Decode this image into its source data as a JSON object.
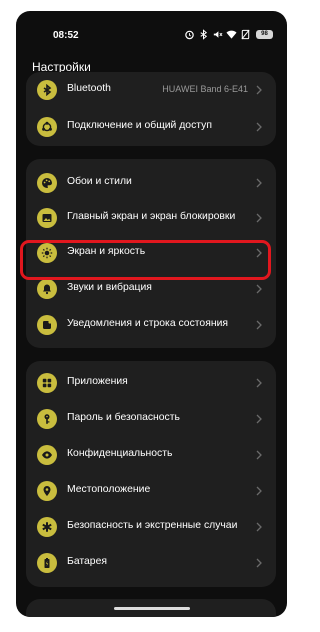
{
  "status_bar": {
    "time": "08:52",
    "icons": [
      "alarm-icon",
      "bluetooth-icon",
      "silent-icon",
      "wifi-icon",
      "no-sim-icon"
    ],
    "battery": "98"
  },
  "header": {
    "title": "Настройки"
  },
  "groups": [
    {
      "items": [
        {
          "label": "Bluetooth",
          "value": "HUAWEI Band 6-E41",
          "icon": "bluetooth-icon"
        },
        {
          "label": "Подключение и общий доступ",
          "icon": "share-icon"
        }
      ]
    },
    {
      "items": [
        {
          "label": "Обои и стили",
          "icon": "palette-icon"
        },
        {
          "label": "Главный экран и экран блокировки",
          "icon": "image-icon"
        },
        {
          "label": "Экран и яркость",
          "icon": "brightness-icon",
          "highlighted": true
        },
        {
          "label": "Звуки и вибрация",
          "icon": "bell-icon"
        },
        {
          "label": "Уведомления и строка состояния",
          "icon": "notification-icon"
        }
      ]
    },
    {
      "items": [
        {
          "label": "Приложения",
          "icon": "apps-icon"
        },
        {
          "label": "Пароль и безопасность",
          "icon": "key-icon"
        },
        {
          "label": "Конфиденциальность",
          "icon": "eye-icon"
        },
        {
          "label": "Местоположение",
          "icon": "location-icon"
        },
        {
          "label": "Безопасность и экстренные случаи",
          "icon": "emergency-icon"
        },
        {
          "label": "Батарея",
          "icon": "battery-icon"
        }
      ]
    }
  ],
  "colors": {
    "background": "#0e0e0e",
    "card": "#1f1f1f",
    "icon_accent": "#c9bd3e",
    "highlight": "#e1171e"
  }
}
